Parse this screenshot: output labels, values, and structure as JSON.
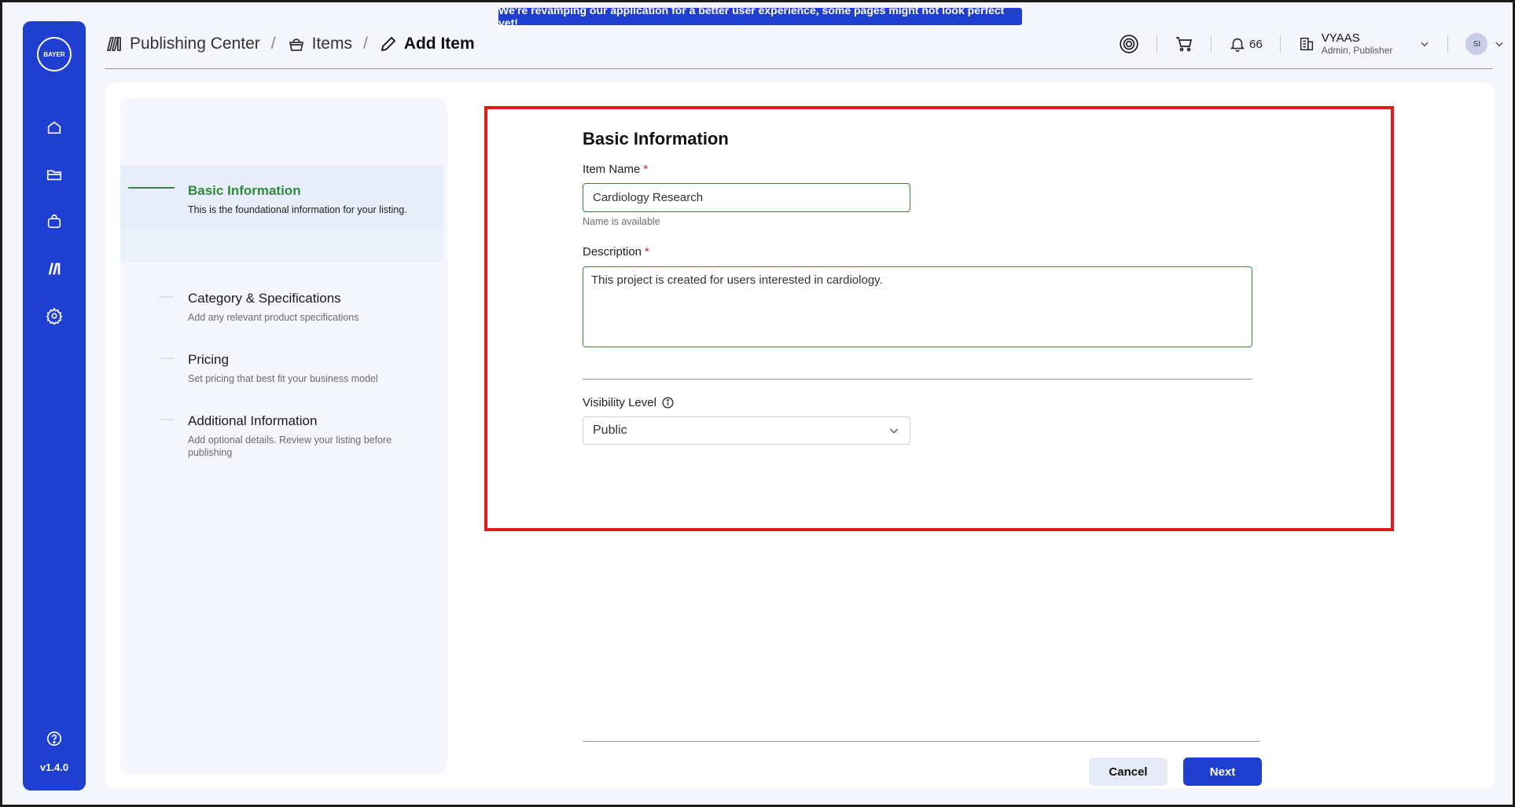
{
  "banner": "We're revamping our application for a better user experience, some pages might not look perfect yet!",
  "sidebar": {
    "logo_text": "BAYER",
    "items": [
      {
        "icon": "home-icon"
      },
      {
        "icon": "folder-icon"
      },
      {
        "icon": "bag-icon"
      },
      {
        "icon": "publishing-icon"
      },
      {
        "icon": "settings-icon"
      }
    ],
    "help_icon": "help-icon",
    "version": "v1.4.0"
  },
  "breadcrumb": [
    {
      "label": "Publishing Center",
      "icon": "publishing-icon"
    },
    {
      "label": "Items",
      "icon": "basket-icon"
    },
    {
      "label": "Add Item",
      "icon": "pencil-icon"
    }
  ],
  "header": {
    "notifications_count": "66",
    "org_name": "VYAAS",
    "org_role": "Admin, Publisher",
    "avatar_initials": "SI"
  },
  "steps": [
    {
      "title": "Basic Information",
      "desc": "This is the foundational information for your listing.",
      "active": true
    },
    {
      "title": "Category & Specifications",
      "desc": "Add any relevant product specifications",
      "active": false
    },
    {
      "title": "Pricing",
      "desc": "Set pricing that best fit your business model",
      "active": false
    },
    {
      "title": "Additional Information",
      "desc": "Add optional details. Review your listing before publishing",
      "active": false
    }
  ],
  "form": {
    "title": "Basic Information",
    "item_name_label": "Item Name",
    "item_name_value": "Cardiology Research",
    "item_name_helper": "Name is available",
    "description_label": "Description",
    "description_value": "This project is created for users interested in cardiology.",
    "required_mark": "*",
    "visibility_label": "Visibility Level",
    "visibility_value": "Public"
  },
  "buttons": {
    "cancel": "Cancel",
    "next": "Next"
  },
  "colors": {
    "primary": "#1f3fd1",
    "success": "#2f8a3a",
    "highlight": "#e01b1b"
  }
}
